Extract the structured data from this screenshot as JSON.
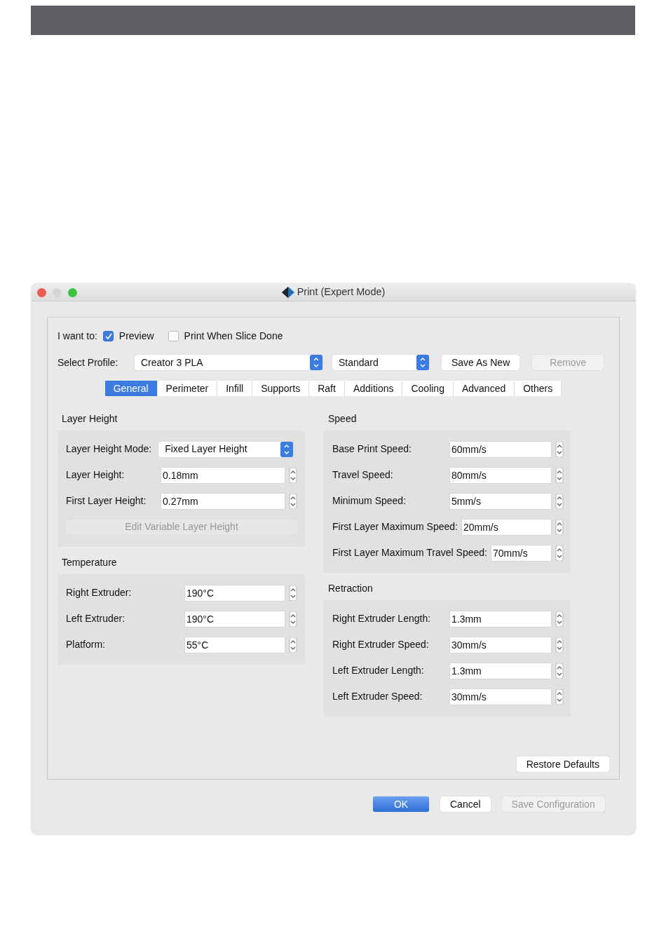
{
  "window": {
    "title": "Print (Expert Mode)"
  },
  "mode": {
    "label": "I want to:",
    "options": [
      {
        "label": "Preview",
        "checked": true
      },
      {
        "label": "Print When Slice Done",
        "checked": false
      }
    ]
  },
  "profile": {
    "label": "Select Profile:",
    "profile": "Creator 3 PLA",
    "quality": "Standard",
    "buttons": [
      {
        "label": "Save As New",
        "disabled": false
      },
      {
        "label": "Remove",
        "disabled": true
      }
    ]
  },
  "tabs": [
    {
      "label": "General",
      "selected": true
    },
    {
      "label": "Perimeter",
      "selected": false
    },
    {
      "label": "Infill",
      "selected": false
    },
    {
      "label": "Supports",
      "selected": false
    },
    {
      "label": "Raft",
      "selected": false
    },
    {
      "label": "Additions",
      "selected": false
    },
    {
      "label": "Cooling",
      "selected": false
    },
    {
      "label": "Advanced",
      "selected": false
    },
    {
      "label": "Others",
      "selected": false
    }
  ],
  "left_sections": [
    {
      "title": "Layer Height",
      "items": [
        {
          "kind": "select",
          "label": "Layer Height Mode:",
          "value": "Fixed Layer Height"
        },
        {
          "kind": "spin",
          "label": "Layer Height:",
          "value": "0.18mm"
        },
        {
          "kind": "spin",
          "label": "First Layer Height:",
          "value": "0.27mm"
        },
        {
          "kind": "button",
          "label": "Edit Variable Layer Height",
          "disabled": true
        }
      ]
    },
    {
      "title": "Temperature",
      "items": [
        {
          "kind": "spin",
          "label": "Right Extruder:",
          "value": "190°C"
        },
        {
          "kind": "spin",
          "label": "Left Extruder:",
          "value": "190°C"
        },
        {
          "kind": "spin",
          "label": "Platform:",
          "value": "55°C"
        }
      ]
    }
  ],
  "right_sections": [
    {
      "title": "Speed",
      "items": [
        {
          "kind": "spin",
          "label": "Base Print Speed:",
          "value": "60mm/s"
        },
        {
          "kind": "spin",
          "label": "Travel Speed:",
          "value": "80mm/s"
        },
        {
          "kind": "spin",
          "label": "Minimum Speed:",
          "value": "5mm/s"
        },
        {
          "kind": "spin",
          "label": "First Layer Maximum Speed:",
          "value": "20mm/s"
        },
        {
          "kind": "spin",
          "label": "First Layer Maximum Travel Speed:",
          "value": "70mm/s"
        }
      ]
    },
    {
      "title": "Retraction",
      "items": [
        {
          "kind": "spin",
          "label": "Right Extruder Length:",
          "value": "1.3mm"
        },
        {
          "kind": "spin",
          "label": "Right Extruder Speed:",
          "value": "30mm/s"
        },
        {
          "kind": "spin",
          "label": "Left Extruder Length:",
          "value": "1.3mm"
        },
        {
          "kind": "spin",
          "label": "Left Extruder Speed:",
          "value": "30mm/s"
        }
      ]
    }
  ],
  "restore_button": "Restore Defaults",
  "footer_buttons": [
    {
      "label": "OK",
      "kind": "default",
      "disabled": false
    },
    {
      "label": "Cancel",
      "kind": "normal",
      "disabled": false
    },
    {
      "label": "Save Configuration",
      "kind": "normal",
      "disabled": true
    }
  ]
}
